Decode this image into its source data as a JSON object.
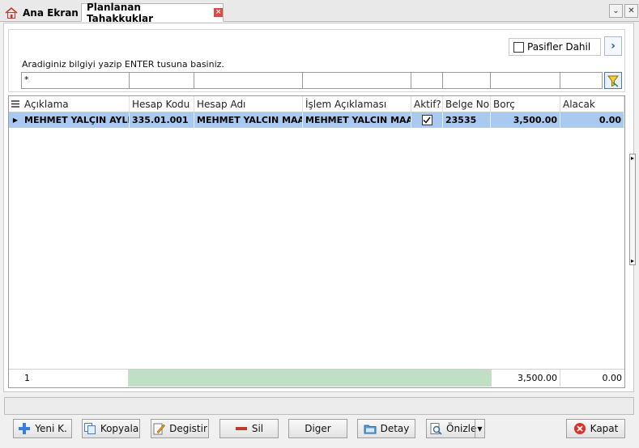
{
  "tabs": {
    "home_label": "Ana Ekran",
    "active_label": "Planlanan Tahakkuklar",
    "close_glyph": "×"
  },
  "window": {
    "dropdown_glyph": "⌄",
    "close_glyph": "✕"
  },
  "filter": {
    "pasif_label": "Pasifler Dahil",
    "hint": "Aradiginiz bilgiyi yazip ENTER tusuna basiniz.",
    "first_value": "*",
    "next_glyph": "›"
  },
  "grid": {
    "columns": [
      "Açıklama",
      "Hesap Kodu",
      "Hesap Adı",
      "İşlem Açıklaması",
      "Aktif?",
      "Belge No",
      "Borç",
      "Alacak"
    ],
    "row": {
      "aciklama": "MEHMET YALÇIN AYLIK",
      "hesap_kodu": "335.01.001",
      "hesap_adi": "MEHMET YALCIN MAAS",
      "islem_aciklamasi": "MEHMET YALCIN MAAS",
      "aktif": true,
      "belge_no": "23535",
      "borc": "3,500.00",
      "alacak": "0.00"
    },
    "footer": {
      "count": "1",
      "borc_total": "3,500.00",
      "alacak_total": "0.00"
    }
  },
  "buttons": {
    "yeni": "Yeni K.",
    "kopyala": "Kopyala",
    "degistir": "Degistir",
    "sil": "Sil",
    "diger": "Diger",
    "detay": "Detay",
    "onizle": "Önizle",
    "kapat": "Kapat"
  },
  "colors": {
    "selected_row": "#a9c9f0",
    "footer_bar": "#bfe0c4",
    "accent": "#1a5ba6"
  }
}
